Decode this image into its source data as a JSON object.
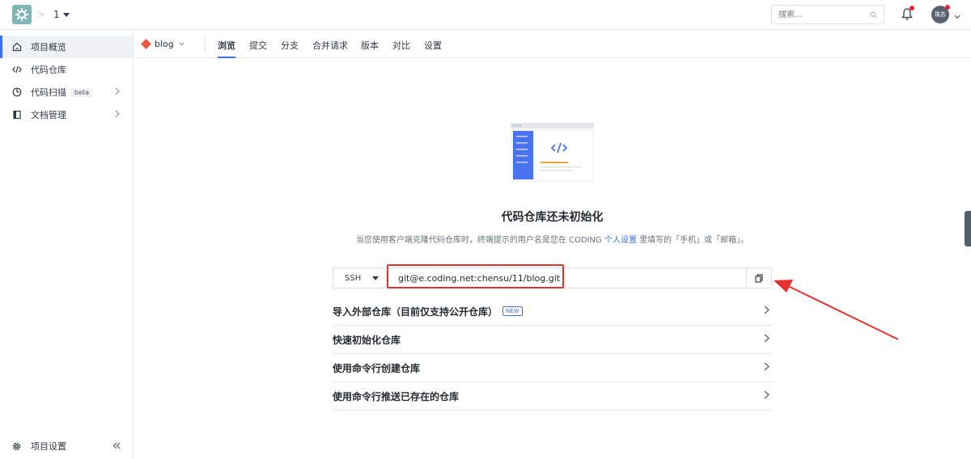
{
  "header": {
    "project_switch": "1",
    "search_placeholder": "搜索...",
    "avatar_text": "珠苏"
  },
  "sidebar": {
    "items": [
      {
        "label": "项目概览",
        "active": true
      },
      {
        "label": "代码仓库",
        "active": false
      },
      {
        "label": "代码扫描",
        "badge": "beta",
        "active": false
      },
      {
        "label": "文档管理",
        "active": false
      }
    ],
    "bottom": {
      "label": "项目设置"
    }
  },
  "repo": {
    "name": "blog",
    "tabs": [
      "浏览",
      "提交",
      "分支",
      "合并请求",
      "版本",
      "对比",
      "设置"
    ],
    "active_tab": "浏览"
  },
  "empty_state": {
    "title": "代码仓库还未初始化",
    "desc_prefix": "当您使用客户端克隆代码仓库时，终端提示的用户名是您在 CODING ",
    "desc_link": "个人设置",
    "desc_suffix": " 里填写的「手机」或「邮箱」。"
  },
  "clone": {
    "protocol": "SSH",
    "url": "git@e.coding.net:chensu/11/blog.git"
  },
  "options": [
    {
      "label": "导入外部仓库（目前仅支持公开仓库）",
      "badge": "NEW"
    },
    {
      "label": "快速初始化仓库"
    },
    {
      "label": "使用命令行创建仓库"
    },
    {
      "label": "使用命令行推送已存在的仓库"
    }
  ],
  "colors": {
    "accent": "#3e6fef",
    "highlight": "#e5322e",
    "logo_bg": "#7db6b4"
  }
}
